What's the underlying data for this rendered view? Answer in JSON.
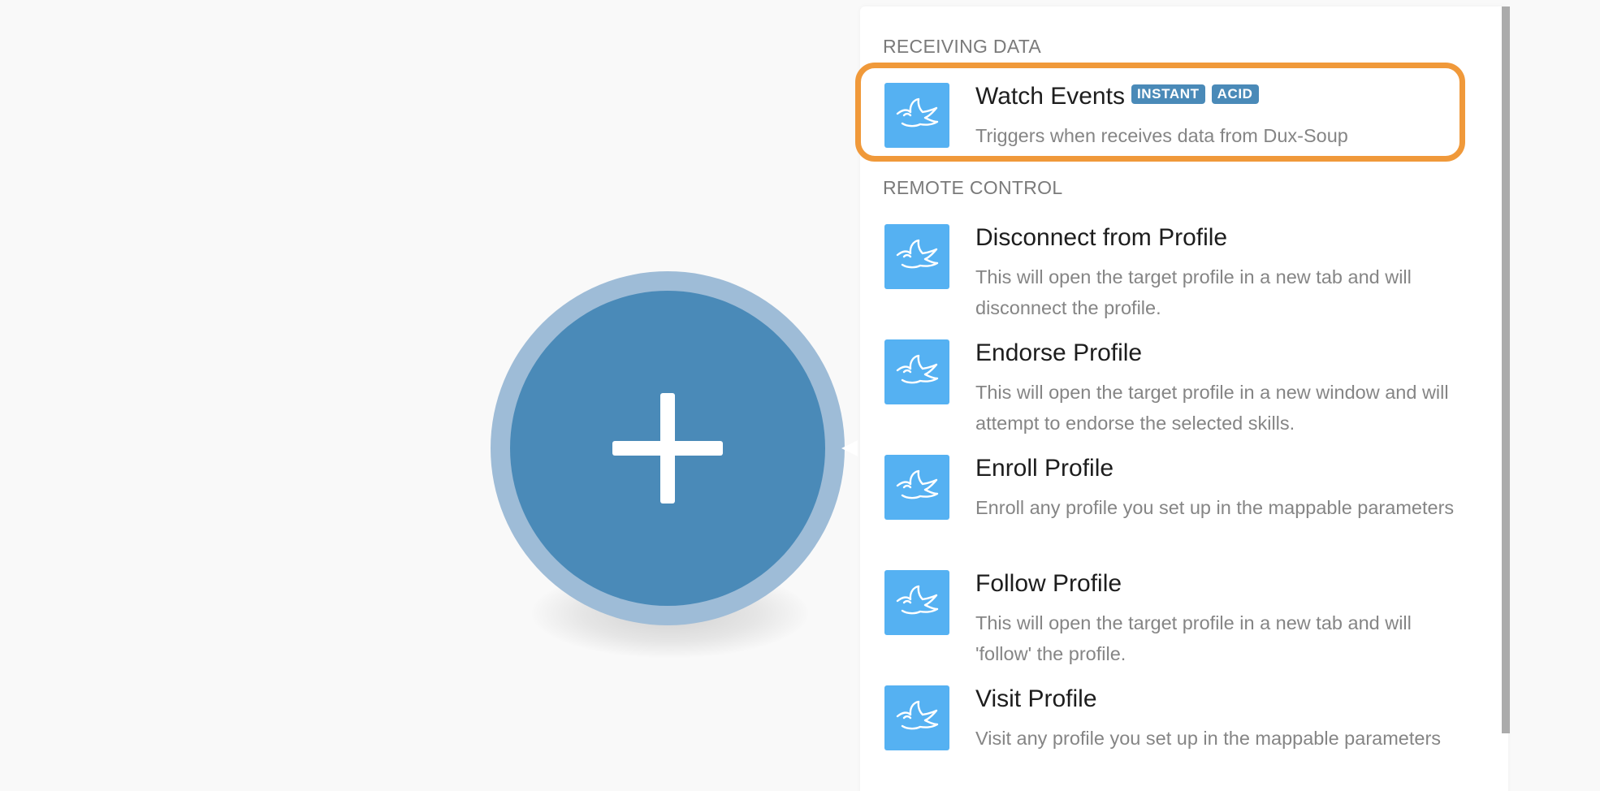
{
  "sections": {
    "receiving": {
      "header": "RECEIVING DATA"
    },
    "remote": {
      "header": "REMOTE CONTROL"
    }
  },
  "items": [
    {
      "title": "Watch Events",
      "badges": [
        "INSTANT",
        "ACID"
      ],
      "description": "Triggers when receives data from Dux-Soup"
    },
    {
      "title": "Disconnect from Profile",
      "description": "This will open the target profile in a new tab and will disconnect the profile."
    },
    {
      "title": "Endorse Profile",
      "description": "This will open the target profile in a new window and will attempt to endorse the selected skills."
    },
    {
      "title": "Enroll Profile",
      "description": "Enroll any profile you set up in the mappable parameters"
    },
    {
      "title": "Follow Profile",
      "description": "This will open the target profile in a new tab and will 'follow' the profile."
    },
    {
      "title": "Visit Profile",
      "description": "Visit any profile you set up in the mappable parameters"
    }
  ],
  "icons": {
    "module_button": "plus-icon",
    "app_icon": "dux-soup-duck-icon"
  },
  "colors": {
    "app_icon_bg": "#55b1f2",
    "module_button": "#4a8ab8",
    "module_button_ring": "#9ebcd7",
    "badge_bg": "#4a8ab8",
    "highlight": "#f0993a"
  }
}
